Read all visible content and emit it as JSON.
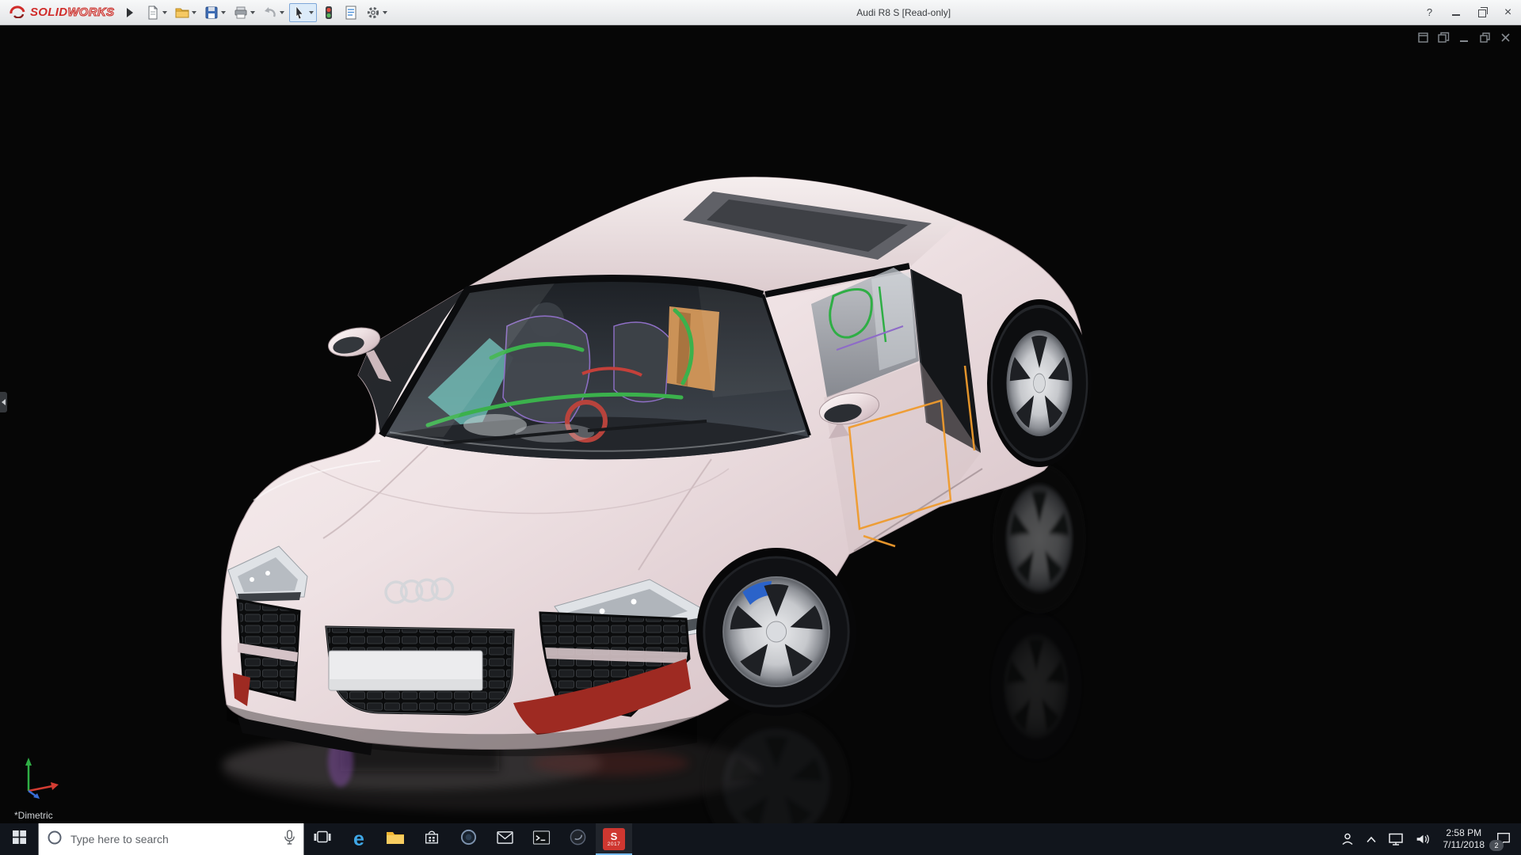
{
  "title_bar": {
    "brand_solid": "SOLID",
    "brand_works": "WORKS",
    "document_title": "Audi R8 S [Read-only]",
    "window_controls": {
      "help": "?",
      "close": "×"
    },
    "toolbar_icons": [
      "new-document",
      "open",
      "save",
      "print",
      "undo",
      "select",
      "rebuild",
      "file-properties",
      "options"
    ],
    "pressed_tool": "select"
  },
  "viewport": {
    "orientation_label": "*Dimetric",
    "mdi_controls": [
      "new-window",
      "cascade",
      "minimize",
      "restore",
      "close"
    ],
    "scene": {
      "model": "Audi R8 S",
      "body_color": "#ece0e2",
      "background_color": "#060606",
      "sketch_highlight_color": "#ef9b2d"
    }
  },
  "taskbar": {
    "search": {
      "placeholder": "Type here to search"
    },
    "icons": {
      "edge_glyph": "e"
    },
    "app_icons": [
      "task-view",
      "edge",
      "file-explorer",
      "store",
      "circle-app",
      "mail",
      "command-prompt",
      "dark-app",
      "solidworks-2017"
    ],
    "tray_icons": [
      "people",
      "hidden-icons-chevron",
      "network",
      "volume",
      "action-center"
    ],
    "solidworks_icon": {
      "letter": "S",
      "year": "2017"
    },
    "clock": {
      "time": "2:58 PM",
      "date": "7/11/2018"
    },
    "notification_count": "2"
  },
  "colors": {
    "brand_red": "#d02c2a",
    "titlebar_bg": "#eceef0",
    "taskbar_bg": "#11151c",
    "active_app_underline": "#76b9ed"
  }
}
